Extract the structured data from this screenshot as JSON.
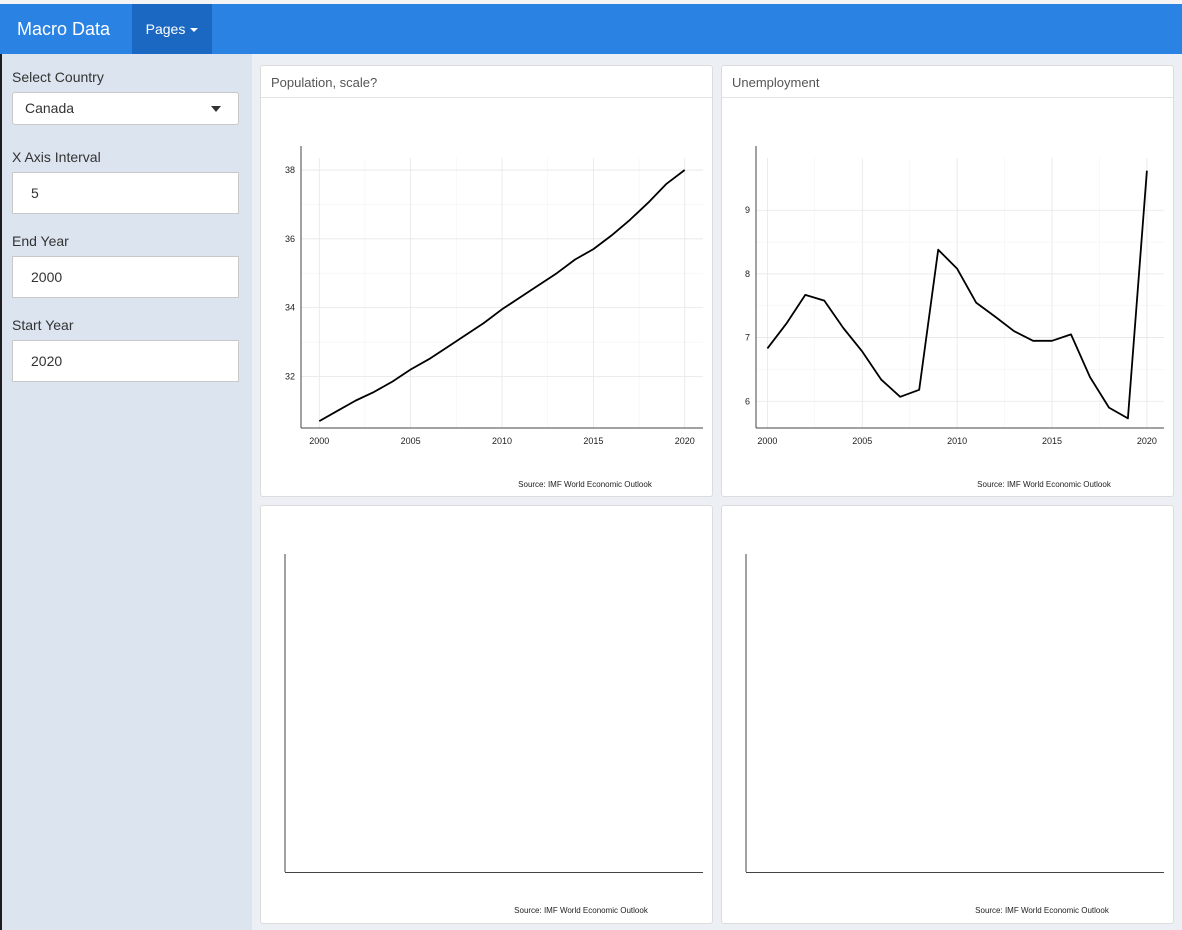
{
  "navbar": {
    "brand": "Macro Data",
    "pages_label": "Pages"
  },
  "sidebar": {
    "country_label": "Select Country",
    "country_value": "Canada",
    "interval_label": "X Axis Interval",
    "interval_value": "5",
    "end_year_label": "End Year",
    "end_year_value": "2000",
    "start_year_label": "Start Year",
    "start_year_value": "2020"
  },
  "panels": {
    "population": {
      "title": "Population, scale?",
      "source": "Source: IMF World Economic Outlook"
    },
    "unemployment": {
      "title": "Unemployment",
      "source": "Source: IMF World Economic Outlook"
    },
    "empty1": {
      "source": "Source: IMF World Economic Outlook"
    },
    "empty2": {
      "source": "Source: IMF World Economic Outlook"
    }
  },
  "chart_data": [
    {
      "type": "line",
      "title": "Population, scale?",
      "x": [
        2000,
        2001,
        2002,
        2003,
        2004,
        2005,
        2006,
        2007,
        2008,
        2009,
        2010,
        2011,
        2012,
        2013,
        2014,
        2015,
        2016,
        2017,
        2018,
        2019,
        2020
      ],
      "series": [
        {
          "values": [
            30.7,
            31.0,
            31.3,
            31.55,
            31.85,
            32.2,
            32.5,
            32.85,
            33.2,
            33.55,
            33.95,
            34.3,
            34.65,
            35.0,
            35.4,
            35.7,
            36.1,
            36.55,
            37.05,
            37.6,
            38.0
          ]
        }
      ],
      "xticks": [
        2000,
        2005,
        2010,
        2015,
        2020
      ],
      "yticks": [
        32,
        34,
        36,
        38
      ],
      "xlim": [
        1999,
        2021
      ],
      "ylim": [
        30.5,
        38.35
      ],
      "grid": true,
      "annotation": "Source: IMF World Economic Outlook"
    },
    {
      "type": "line",
      "title": "Unemployment",
      "x": [
        2000,
        2001,
        2002,
        2003,
        2004,
        2005,
        2006,
        2007,
        2008,
        2009,
        2010,
        2011,
        2012,
        2013,
        2014,
        2015,
        2016,
        2017,
        2018,
        2019,
        2020
      ],
      "series": [
        {
          "values": [
            6.83,
            7.22,
            7.67,
            7.58,
            7.15,
            6.78,
            6.34,
            6.07,
            6.18,
            8.38,
            8.08,
            7.55,
            7.33,
            7.1,
            6.95,
            6.95,
            7.05,
            6.38,
            5.9,
            5.73,
            9.62
          ]
        }
      ],
      "xticks": [
        2000,
        2005,
        2010,
        2015,
        2020
      ],
      "yticks": [
        6,
        7,
        8,
        9
      ],
      "xlim": [
        1999.4,
        2020.9
      ],
      "ylim": [
        5.58,
        9.82
      ],
      "grid": true,
      "annotation": "Source: IMF World Economic Outlook"
    }
  ]
}
